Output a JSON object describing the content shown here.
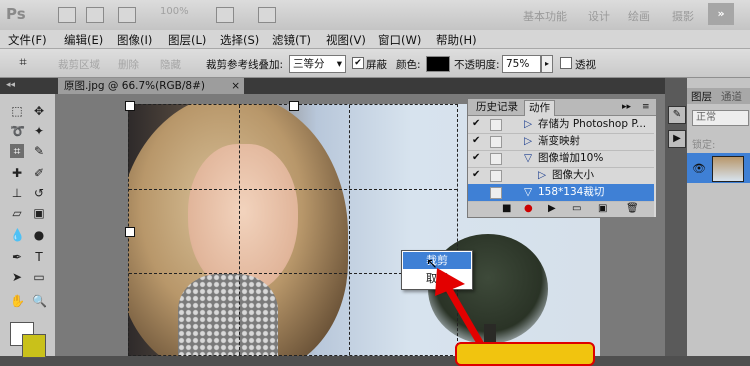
{
  "app": {
    "logo": "Ps",
    "zoom": "100%",
    "workspaces": [
      "基本功能",
      "设计",
      "绘画",
      "摄影"
    ],
    "more": "»"
  },
  "menu": [
    "文件(F)",
    "编辑(E)",
    "图像(I)",
    "图层(L)",
    "选择(S)",
    "滤镜(T)",
    "视图(V)",
    "窗口(W)",
    "帮助(H)"
  ],
  "options": {
    "crop_overlay_label": "裁剪参考线叠加:",
    "crop_overlay_value": "三等分",
    "shield_label": "屏蔽",
    "shield_checked": true,
    "color_label": "颜色:",
    "shield_color": "#000000",
    "opacity_label": "不透明度:",
    "opacity_value": "75%",
    "perspective_label": "透视",
    "perspective_checked": false,
    "delete_label": "删除",
    "hide_label": "隐藏"
  },
  "document": {
    "tab_title": "原图.jpg @ 66.7%(RGB/8#)",
    "close": "×"
  },
  "panel": {
    "tabs": [
      "历史记录",
      "动作"
    ],
    "active_tab": "动作",
    "rows": [
      {
        "label": "存储为 Photoshop P...",
        "indent": 1,
        "checked": true,
        "expanded": false,
        "selected": false
      },
      {
        "label": "渐变映射",
        "indent": 1,
        "checked": true,
        "expanded": false,
        "selected": false
      },
      {
        "label": "图像增加10%",
        "indent": 1,
        "checked": true,
        "expanded": true,
        "selected": false
      },
      {
        "label": "图像大小",
        "indent": 2,
        "checked": true,
        "expanded": false,
        "selected": false
      },
      {
        "label": "158*134裁切",
        "indent": 1,
        "checked": false,
        "expanded": true,
        "selected": true
      }
    ]
  },
  "context_menu": {
    "items": [
      "裁剪",
      "取消"
    ],
    "highlighted": "裁剪"
  },
  "layers": {
    "tabs": [
      "图层",
      "通道"
    ],
    "blend_mode": "正常",
    "lock_label": "锁定:"
  },
  "colors": {
    "accent": "#3f80d5",
    "callout_border": "#dd0000",
    "callout_fill": "#f1c40f"
  }
}
